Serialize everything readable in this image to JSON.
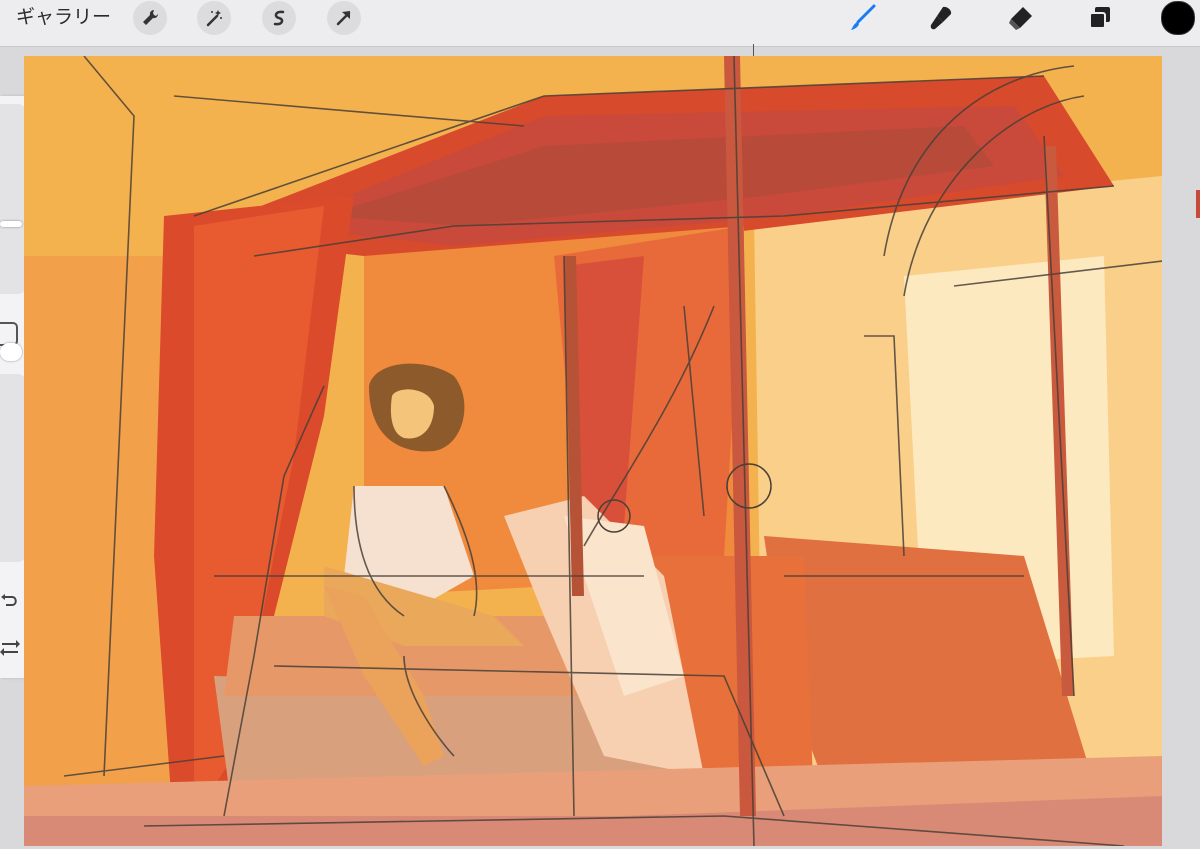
{
  "app": {
    "gallery_label": "ギャラリー"
  },
  "toolbar": {
    "left_tools": [
      {
        "name": "actions",
        "icon": "wrench-icon"
      },
      {
        "name": "adjustments",
        "icon": "magic-wand-icon"
      },
      {
        "name": "selection",
        "icon": "selection-s-icon"
      },
      {
        "name": "transform",
        "icon": "arrow-cursor-icon"
      }
    ],
    "right_tools": [
      {
        "name": "brush",
        "icon": "brush-icon",
        "active": true
      },
      {
        "name": "smudge",
        "icon": "smudge-icon",
        "active": false
      },
      {
        "name": "eraser",
        "icon": "eraser-icon",
        "active": false
      },
      {
        "name": "layers",
        "icon": "layers-icon",
        "active": false
      }
    ],
    "current_color": "#000000"
  },
  "sidebar": {
    "brush_size_level": 0.35,
    "opacity_level": 0.2,
    "icons": [
      "modify-square-icon",
      "undo-icon",
      "redo-icon"
    ]
  },
  "colors": {
    "accent": "#1a7cf5",
    "canvas_bg": "#f4b24e",
    "canopy_red": "#d6452c",
    "bed_pink": "#d9a07e"
  }
}
